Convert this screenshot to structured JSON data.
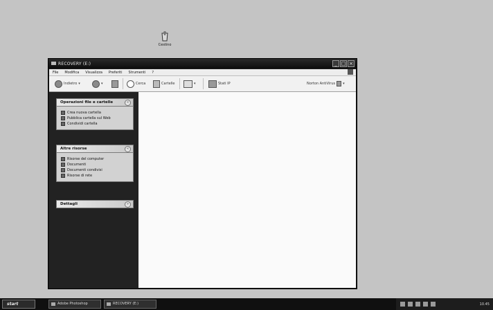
{
  "desktop": {
    "icon_label": "Cestino"
  },
  "window": {
    "title": "RECOVERY (E:)",
    "minimize": "_",
    "maximize": "□",
    "close": "×"
  },
  "menubar": [
    "File",
    "Modifica",
    "Visualizza",
    "Preferiti",
    "Strumenti",
    "?"
  ],
  "toolbar": {
    "back": "Indietro",
    "search": "Cerca",
    "folders": "Cartelle",
    "extra": "Stati IP",
    "address_label": "Norton AntiVirus"
  },
  "leftpane": {
    "file_tasks": {
      "title": "Operazioni file e cartelle",
      "items": [
        "Crea nuova cartella",
        "Pubblica cartella sul Web",
        "Condividi cartella"
      ]
    },
    "other_places": {
      "title": "Altre risorse",
      "items": [
        "Risorse del computer",
        "Documenti",
        "Documenti condivisi",
        "Risorse di rete"
      ]
    },
    "details": {
      "title": "Dettagli"
    }
  },
  "taskbar": {
    "start": "start",
    "tasks": [
      "Adobe Photoshop",
      "RECOVERY (E:)"
    ],
    "clock": "10.45"
  }
}
